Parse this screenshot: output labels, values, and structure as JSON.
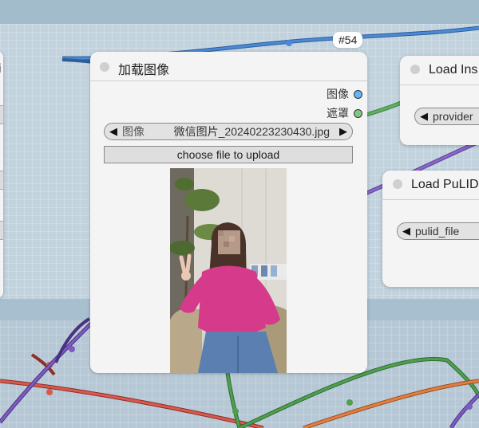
{
  "load_image_node": {
    "title": "加载图像",
    "id_badge": "#54",
    "outputs": [
      {
        "label": "图像",
        "color": "#64b5f6"
      },
      {
        "label": "遮罩",
        "color": "#81c784"
      }
    ],
    "image_widget": {
      "name": "图像",
      "value": "微信图片_20240223230430.jpg"
    },
    "upload_label": "choose file to upload"
  },
  "load_insightface_node": {
    "title": "Load Ins",
    "provider_widget": {
      "name": "provider"
    }
  },
  "load_pulid_node": {
    "title": "Load PuLID",
    "pulid_file_widget": {
      "name": "pulid_file"
    }
  },
  "left_node_fragment": {
    "title_char": "i"
  },
  "colors": {
    "wire_blue": "#3f7fc4",
    "wire_green": "#4e9a4f",
    "wire_purple": "#7a58b8",
    "wire_red": "#d04a3e",
    "wire_orange": "#d8743a",
    "canvas": "#b6c8d5"
  }
}
